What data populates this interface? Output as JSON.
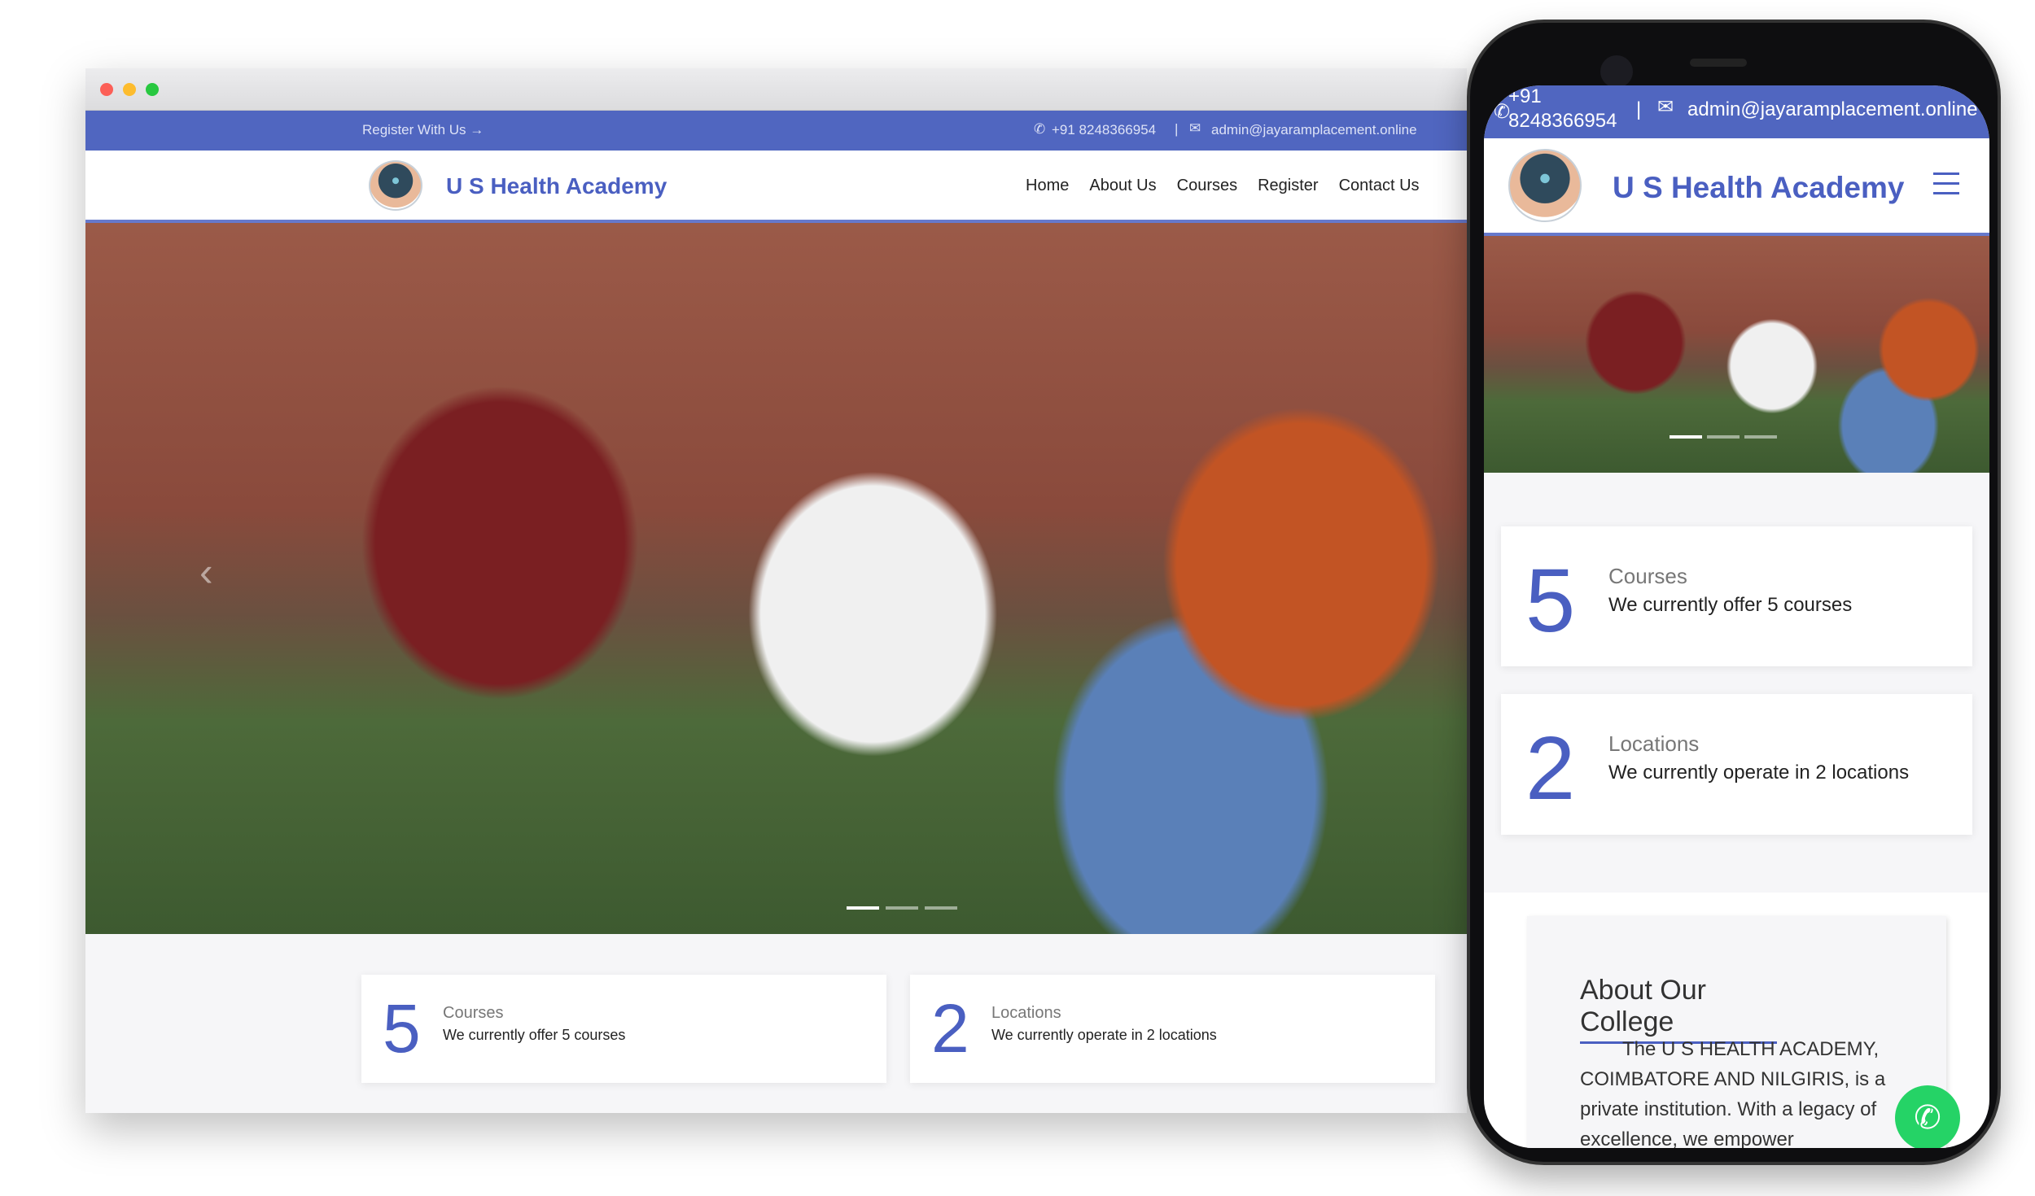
{
  "desktop": {
    "window_controls": [
      "close",
      "minimize",
      "maximize"
    ],
    "topbar": {
      "register_link": "Register With Us →",
      "phone": "+91 8248366954",
      "separator": "|",
      "email": "admin@jayaramplacement.online"
    },
    "header": {
      "brand": "U S Health Academy",
      "nav": [
        "Home",
        "About Us",
        "Courses",
        "Register",
        "Contact Us"
      ]
    },
    "hero": {
      "prev_icon": "chevron-left-icon",
      "slides": 3,
      "active_slide": 1
    },
    "stats": [
      {
        "number": "5",
        "title": "Courses",
        "desc": "We currently offer 5 courses"
      },
      {
        "number": "2",
        "title": "Locations",
        "desc": "We currently operate in 2 locations"
      }
    ]
  },
  "mobile": {
    "topbar": {
      "phone_line1": "+91",
      "phone_line2": "8248366954",
      "separator": "|",
      "email": "admin@jayaramplacement.online"
    },
    "header": {
      "brand": "U S Health Academy",
      "menu_icon": "hamburger-icon"
    },
    "stats": [
      {
        "number": "5",
        "title": "Courses",
        "desc": "We currently offer 5 courses"
      },
      {
        "number": "2",
        "title": "Locations",
        "desc": "We currently operate in 2 locations"
      }
    ],
    "about": {
      "title": "About Our College",
      "text": "The U S HEALTH ACADEMY, COIMBATORE AND NILGIRIS, is a private institution. With a legacy of excellence, we empower"
    },
    "whatsapp_icon": "whatsapp-icon"
  },
  "colors": {
    "accent": "#5066c0",
    "brand_text": "#4a5fc1",
    "whatsapp": "#25d366"
  }
}
